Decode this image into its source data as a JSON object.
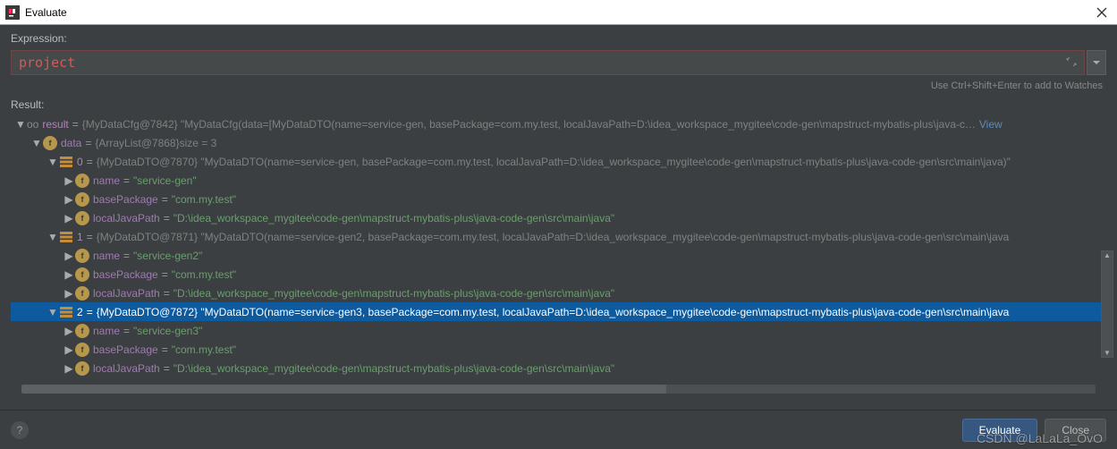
{
  "window": {
    "title": "Evaluate"
  },
  "labels": {
    "expression": "Expression:",
    "result": "Result:",
    "hint": "Use Ctrl+Shift+Enter to add to Watches"
  },
  "expression": {
    "value": "project"
  },
  "buttons": {
    "evaluate": "Evaluate",
    "close": "Close",
    "help": "?"
  },
  "tree": {
    "result": {
      "name": "result",
      "type": "{MyDataCfg@7842}",
      "value": "\"MyDataCfg(data=[MyDataDTO(name=service-gen, basePackage=com.my.test, localJavaPath=D:\\idea_workspace_mygitee\\code-gen\\mapstruct-mybatis-plus\\java-c…",
      "viewText": "View"
    },
    "data": {
      "name": "data",
      "type": "{ArrayList@7868}",
      "sizeLabel": " size = 3"
    },
    "items": [
      {
        "idx": "0",
        "type": "{MyDataDTO@7870}",
        "summary": "\"MyDataDTO(name=service-gen, basePackage=com.my.test, localJavaPath=D:\\idea_workspace_mygitee\\code-gen\\mapstruct-mybatis-plus\\java-code-gen\\src\\main\\java)\"",
        "name": "\"service-gen\"",
        "basePackage": "\"com.my.test\"",
        "localJavaPath": "\"D:\\idea_workspace_mygitee\\code-gen\\mapstruct-mybatis-plus\\java-code-gen\\src\\main\\java\""
      },
      {
        "idx": "1",
        "type": "{MyDataDTO@7871}",
        "summary": "\"MyDataDTO(name=service-gen2, basePackage=com.my.test, localJavaPath=D:\\idea_workspace_mygitee\\code-gen\\mapstruct-mybatis-plus\\java-code-gen\\src\\main\\java",
        "name": "\"service-gen2\"",
        "basePackage": "\"com.my.test\"",
        "localJavaPath": "\"D:\\idea_workspace_mygitee\\code-gen\\mapstruct-mybatis-plus\\java-code-gen\\src\\main\\java\""
      },
      {
        "idx": "2",
        "type": "{MyDataDTO@7872}",
        "summary": "\"MyDataDTO(name=service-gen3, basePackage=com.my.test, localJavaPath=D:\\idea_workspace_mygitee\\code-gen\\mapstruct-mybatis-plus\\java-code-gen\\src\\main\\java",
        "name": "\"service-gen3\"",
        "basePackage": "\"com.my.test\"",
        "localJavaPath": "\"D:\\idea_workspace_mygitee\\code-gen\\mapstruct-mybatis-plus\\java-code-gen\\src\\main\\java\""
      }
    ],
    "fieldLabels": {
      "name": "name",
      "basePackage": "basePackage",
      "localJavaPath": "localJavaPath"
    }
  },
  "watermark": "CSDN @LaLaLa_OvO",
  "bgUrl": "http://127.0.0.1:5003/"
}
